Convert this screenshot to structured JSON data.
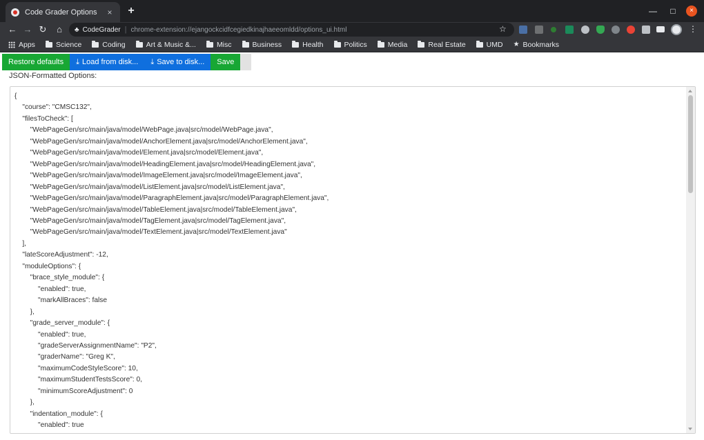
{
  "browser": {
    "tab_title": "Code Grader Options",
    "tab_close": "×",
    "new_tab": "+",
    "win_min": "—",
    "win_max": "□",
    "win_close": "×",
    "site_name": "CodeGrader",
    "url_separator": "|",
    "url": "chrome-extension://ejangockcidfcegiedkinajhaeeomldd/options_ui.html",
    "menu_icon": "⋮"
  },
  "bookmarks": [
    {
      "label": "Apps",
      "icon": "apps-icon"
    },
    {
      "label": "Science",
      "icon": "folder-icon"
    },
    {
      "label": "Coding",
      "icon": "folder-icon"
    },
    {
      "label": "Art & Music &...",
      "icon": "folder-icon"
    },
    {
      "label": "Misc",
      "icon": "folder-icon"
    },
    {
      "label": "Business",
      "icon": "folder-icon"
    },
    {
      "label": "Health",
      "icon": "folder-icon"
    },
    {
      "label": "Politics",
      "icon": "folder-icon"
    },
    {
      "label": "Media",
      "icon": "folder-icon"
    },
    {
      "label": "Real Estate",
      "icon": "folder-icon"
    },
    {
      "label": "UMD",
      "icon": "folder-icon"
    },
    {
      "label": "Bookmarks",
      "icon": "star-icon"
    }
  ],
  "actions": {
    "restore": "Restore defaults",
    "load": "Load from disk...",
    "save_disk": "Save to disk...",
    "save": "Save"
  },
  "section_label": "JSON-Formatted Options:",
  "json_options": "{\n    \"course\": \"CMSC132\",\n    \"filesToCheck\": [\n        \"WebPageGen/src/main/java/model/WebPage.java|src/model/WebPage.java\",\n        \"WebPageGen/src/main/java/model/AnchorElement.java|src/model/AnchorElement.java\",\n        \"WebPageGen/src/main/java/model/Element.java|src/model/Element.java\",\n        \"WebPageGen/src/main/java/model/HeadingElement.java|src/model/HeadingElement.java\",\n        \"WebPageGen/src/main/java/model/ImageElement.java|src/model/ImageElement.java\",\n        \"WebPageGen/src/main/java/model/ListElement.java|src/model/ListElement.java\",\n        \"WebPageGen/src/main/java/model/ParagraphElement.java|src/model/ParagraphElement.java\",\n        \"WebPageGen/src/main/java/model/TableElement.java|src/model/TableElement.java\",\n        \"WebPageGen/src/main/java/model/TagElement.java|src/model/TagElement.java\",\n        \"WebPageGen/src/main/java/model/TextElement.java|src/model/TextElement.java\"\n    ],\n    \"lateScoreAdjustment\": -12,\n    \"moduleOptions\": {\n        \"brace_style_module\": {\n            \"enabled\": true,\n            \"markAllBraces\": false\n        },\n        \"grade_server_module\": {\n            \"enabled\": true,\n            \"gradeServerAssignmentName\": \"P2\",\n            \"graderName\": \"Greg K\",\n            \"maximumCodeStyleScore\": 10,\n            \"maximumStudentTestsScore\": 0,\n            \"minimumScoreAdjustment\": 0\n        },\n        \"indentation_module\": {\n            \"enabled\": true",
  "colors": {
    "green_button": "#18a734",
    "blue_button": "#0f6fde",
    "browser_frame": "#202124",
    "toolbar": "#35363a"
  }
}
